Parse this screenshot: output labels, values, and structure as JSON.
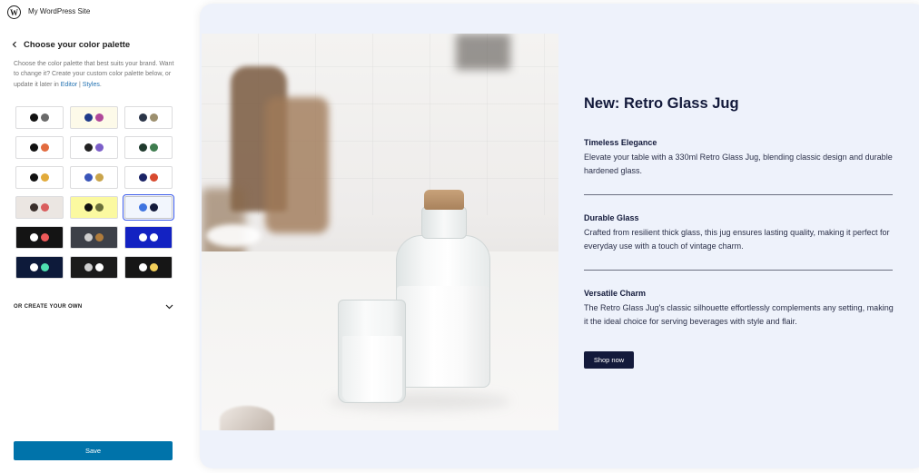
{
  "topbar": {
    "site_title": "My WordPress Site",
    "logo_icon": "wordpress-logo-icon"
  },
  "panel": {
    "title": "Choose your color palette",
    "description": "Choose the color palette that best suits your brand. Want to change it? Create your custom color palette below, or update it later in",
    "link_editor": "Editor",
    "link_separator": " | ",
    "link_styles": "Styles",
    "description_end": "."
  },
  "palettes": [
    {
      "bg": "#ffffff",
      "dots": [
        "#111111",
        "#6a6a6a"
      ],
      "selected": false
    },
    {
      "bg": "#fdfae9",
      "dots": [
        "#1f3a8a",
        "#b0479a"
      ],
      "selected": false
    },
    {
      "bg": "#ffffff",
      "dots": [
        "#2b3548",
        "#9c8f6e"
      ],
      "selected": false
    },
    {
      "bg": "#ffffff",
      "dots": [
        "#111111",
        "#e26b3f"
      ],
      "selected": false
    },
    {
      "bg": "#ffffff",
      "dots": [
        "#222222",
        "#7c5fc9"
      ],
      "selected": false
    },
    {
      "bg": "#ffffff",
      "dots": [
        "#1f3a2d",
        "#3f7d4f"
      ],
      "selected": false
    },
    {
      "bg": "#ffffff",
      "dots": [
        "#111111",
        "#e2ab3b"
      ],
      "selected": false
    },
    {
      "bg": "#ffffff",
      "dots": [
        "#3a55b9",
        "#c9a44b"
      ],
      "selected": false
    },
    {
      "bg": "#ffffff",
      "dots": [
        "#1a2366",
        "#d84a2f"
      ],
      "selected": false
    },
    {
      "bg": "#ebe6e2",
      "dots": [
        "#3a2f2b",
        "#d95d5d"
      ],
      "selected": false
    },
    {
      "bg": "#fbf9a0",
      "dots": [
        "#111111",
        "#6a6f3a"
      ],
      "selected": false
    },
    {
      "bg": "#f2f6fd",
      "dots": [
        "#3f74e0",
        "#131a3b"
      ],
      "selected": true
    },
    {
      "bg": "#141414",
      "dots": [
        "#ffffff",
        "#ee5a5a"
      ],
      "selected": false
    },
    {
      "bg": "#3d4048",
      "dots": [
        "#cfcfcf",
        "#b07c3c"
      ],
      "selected": false
    },
    {
      "bg": "#1322c2",
      "dots": [
        "#ffffff",
        "#ffffff"
      ],
      "selected": false
    },
    {
      "bg": "#0d1a3a",
      "dots": [
        "#ffffff",
        "#4fe0b0"
      ],
      "selected": false
    },
    {
      "bg": "#1b1b1b",
      "dots": [
        "#cfcfcf",
        "#ffffff"
      ],
      "selected": false
    },
    {
      "bg": "#161616",
      "dots": [
        "#ffffff",
        "#f3cf5a"
      ],
      "selected": false
    }
  ],
  "create_own": {
    "label": "OR CREATE YOUR OWN",
    "icon": "chevron-down-icon"
  },
  "save_label": "Save",
  "preview": {
    "title": "New: Retro Glass Jug",
    "features": [
      {
        "heading": "Timeless Elegance",
        "text": "Elevate your table with a 330ml Retro Glass Jug, blending classic design and durable hardened glass."
      },
      {
        "heading": "Durable Glass",
        "text": "Crafted from resilient thick glass, this jug ensures lasting quality, making it perfect for everyday use with a touch of vintage charm."
      },
      {
        "heading": "Versatile Charm",
        "text": "The Retro Glass Jug's classic silhouette effortlessly complements any setting, making it the ideal choice for serving beverages with style and flair."
      }
    ],
    "cta": "Shop now"
  },
  "colors": {
    "accent": "#0073aa",
    "preview_bg": "#eef2fb",
    "preview_text": "#131a3b"
  }
}
